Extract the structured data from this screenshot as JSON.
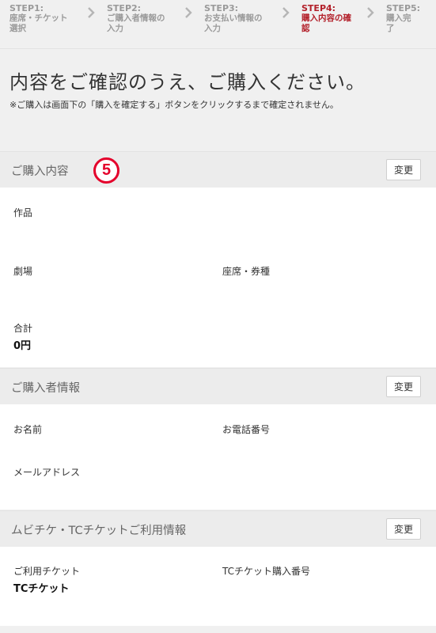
{
  "steps": [
    {
      "num": "STEP1:",
      "label": "座席・チケット選択",
      "line2": "選択",
      "line1": "座席・チケット"
    },
    {
      "num": "STEP2:",
      "line1": "ご購入者情報の",
      "line2": "入力"
    },
    {
      "num": "STEP3:",
      "line1": "お支払い情報の",
      "line2": "入力"
    },
    {
      "num": "STEP4:",
      "line1": "購入内容の確",
      "line2": "認"
    },
    {
      "num": "STEP5:",
      "line1": "購入完",
      "line2": "了"
    }
  ],
  "page": {
    "title": "内容をご確認のうえ、ご購入ください。",
    "notice": "※ご購入は画面下の「購入を確定する」ボタンをクリックするまで確定されません。"
  },
  "annotation": {
    "marker": "5"
  },
  "purchase": {
    "title": "ご購入内容",
    "edit": "変更",
    "work_label": "作品",
    "theater_label": "劇場",
    "seat_label": "座席・券種",
    "total_label": "合計",
    "total_value": "0円"
  },
  "buyer": {
    "title": "ご購入者情報",
    "edit": "変更",
    "name_label": "お名前",
    "phone_label": "お電話番号",
    "email_label": "メールアドレス"
  },
  "mubichike": {
    "title": "ムビチケ・TCチケットご利用情報",
    "edit": "変更",
    "ticket_label": "ご利用チケット",
    "ticket_value": "TCチケット",
    "tc_number_label": "TCチケット購入番号"
  },
  "colors": {
    "active_step": "#b3202a",
    "inactive_step": "#9a9a9a",
    "marker": "#e4002b"
  }
}
